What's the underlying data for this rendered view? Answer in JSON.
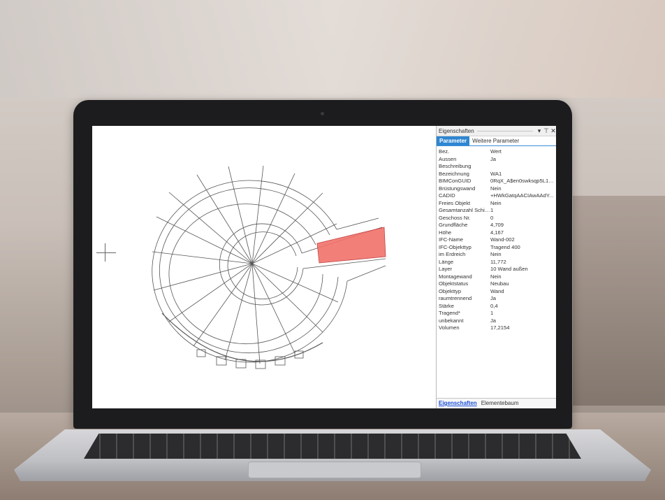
{
  "panel": {
    "title": "Eigenschaften",
    "controls": {
      "dropdown": "▾",
      "pin": "⊤",
      "close": "✕"
    },
    "tabs": [
      {
        "label": "Parameter",
        "active": true
      },
      {
        "label": "Weitere Parameter",
        "active": false
      }
    ],
    "header": {
      "key": "Bez.",
      "value": "Wert"
    },
    "rows": [
      {
        "key": "Aussen",
        "value": "Ja"
      },
      {
        "key": "Beschreibung",
        "value": ""
      },
      {
        "key": "Bezeichnung",
        "value": "WA1"
      },
      {
        "key": "BIMConGUID",
        "value": "0RqX_A$en0swksqp5L15..."
      },
      {
        "key": "Brüstungswand",
        "value": "Nein"
      },
      {
        "key": "CADID",
        "value": "+HWkGatqAACIAwAAdY..."
      },
      {
        "key": "Freies Objekt",
        "value": "Nein"
      },
      {
        "key": "Gesamtanzahl Schich...",
        "value": "1"
      },
      {
        "key": "Geschoss Nr.",
        "value": "0"
      },
      {
        "key": "Grundfläche",
        "value": "4,709"
      },
      {
        "key": "Höhe",
        "value": "4,167"
      },
      {
        "key": "IFC-Name",
        "value": "Wand-002"
      },
      {
        "key": "IFC-Objekttyp",
        "value": "Tragend 400"
      },
      {
        "key": "im Erdreich",
        "value": "Nein"
      },
      {
        "key": "Länge",
        "value": "11,772"
      },
      {
        "key": "Layer",
        "value": "10 Wand außen"
      },
      {
        "key": "Montagewand",
        "value": "Nein"
      },
      {
        "key": "Objektstatus",
        "value": "Neubau"
      },
      {
        "key": "Objekttyp",
        "value": "Wand"
      },
      {
        "key": "raumtrennend",
        "value": "Ja"
      },
      {
        "key": "Stärke",
        "value": "0,4"
      },
      {
        "key": "Tragend*",
        "value": "1"
      },
      {
        "key": "unbekannt",
        "value": "Ja"
      },
      {
        "key": "Volumen",
        "value": "17,2154"
      }
    ],
    "bottom_tabs": [
      {
        "label": "Eigenschaften",
        "active": true
      },
      {
        "label": "Elementebaum",
        "active": false
      }
    ]
  },
  "colors": {
    "accent": "#2e86d1",
    "selection": "#f2726b",
    "wireframe": "#555555"
  }
}
